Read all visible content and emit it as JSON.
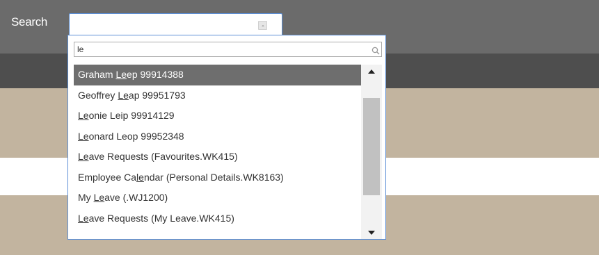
{
  "header": {
    "search_label": "Search"
  },
  "search": {
    "query": "le"
  },
  "results": [
    {
      "before": "Graham ",
      "match": "Le",
      "after": "ep 99914388",
      "highlighted": true
    },
    {
      "before": "Geoffrey ",
      "match": "Le",
      "after": "ap 99951793",
      "highlighted": false
    },
    {
      "before": "",
      "match": "Le",
      "after": "onie Leip 99914129",
      "highlighted": false
    },
    {
      "before": "",
      "match": "Le",
      "after": "onard Leop 99952348",
      "highlighted": false
    },
    {
      "before": "",
      "match": "Le",
      "after": "ave Requests (Favourites.WK415)",
      "highlighted": false
    },
    {
      "before": "Employee Ca",
      "match": "le",
      "after": "ndar (Personal Details.WK8163)",
      "highlighted": false
    },
    {
      "before": "My ",
      "match": "Le",
      "after": "ave (.WJ1200)",
      "highlighted": false
    },
    {
      "before": "",
      "match": "Le",
      "after": "ave Requests (My Leave.WK415)",
      "highlighted": false
    }
  ],
  "icons": {
    "search": "search-icon",
    "scroll_up": "caret-up-icon",
    "scroll_down": "caret-down-icon",
    "select_toggle": "caret-up-small-icon"
  },
  "colors": {
    "header": "#6b6b6b",
    "subheader": "#4e4e4e",
    "content_band": "#c2b49f",
    "highlight": "#6e6e6e",
    "focus_border": "#5c8fd6"
  }
}
